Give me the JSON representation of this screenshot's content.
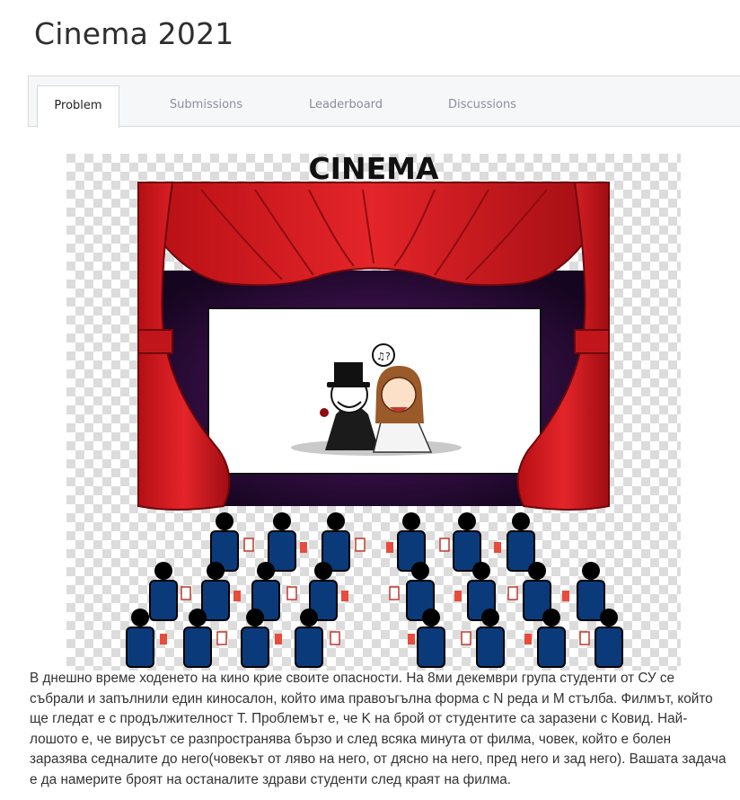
{
  "page": {
    "title": "Cinema 2021"
  },
  "tabs": [
    {
      "label": "Problem",
      "active": true
    },
    {
      "label": "Submissions",
      "active": false
    },
    {
      "label": "Leaderboard",
      "active": false
    },
    {
      "label": "Discussions",
      "active": false
    }
  ],
  "illustration": {
    "heading": "CINEMA",
    "speech_symbol": "♫?"
  },
  "problem": {
    "description": "В днешно време ходенето на кино крие своите опасности. На 8ми декември група студенти от СУ се събрали и запълнили един киносалон, който има правоъгълна форма с N реда и M стълба. Филмът, който ще гледат е с продължителност T. Проблемът е, че K на брой от студентите са заразени с Ковид. Най-лошото е, че вирусът се разпространява бързо и след всяка минута от филма, човек, който е болен заразява седналите до него(човекът от ляво на него, от дясно на него, пред него и зад него). Вашата задача е да намерите броят на останалите здрави студенти след краят на филма."
  },
  "colors": {
    "curtain": "#d0161b",
    "curtain_dark": "#8e0c10",
    "screen_bg": "#2a0b3a",
    "seat": "#0a3a7a",
    "audience": "#000000",
    "tab_bg": "#f6f7f8"
  }
}
